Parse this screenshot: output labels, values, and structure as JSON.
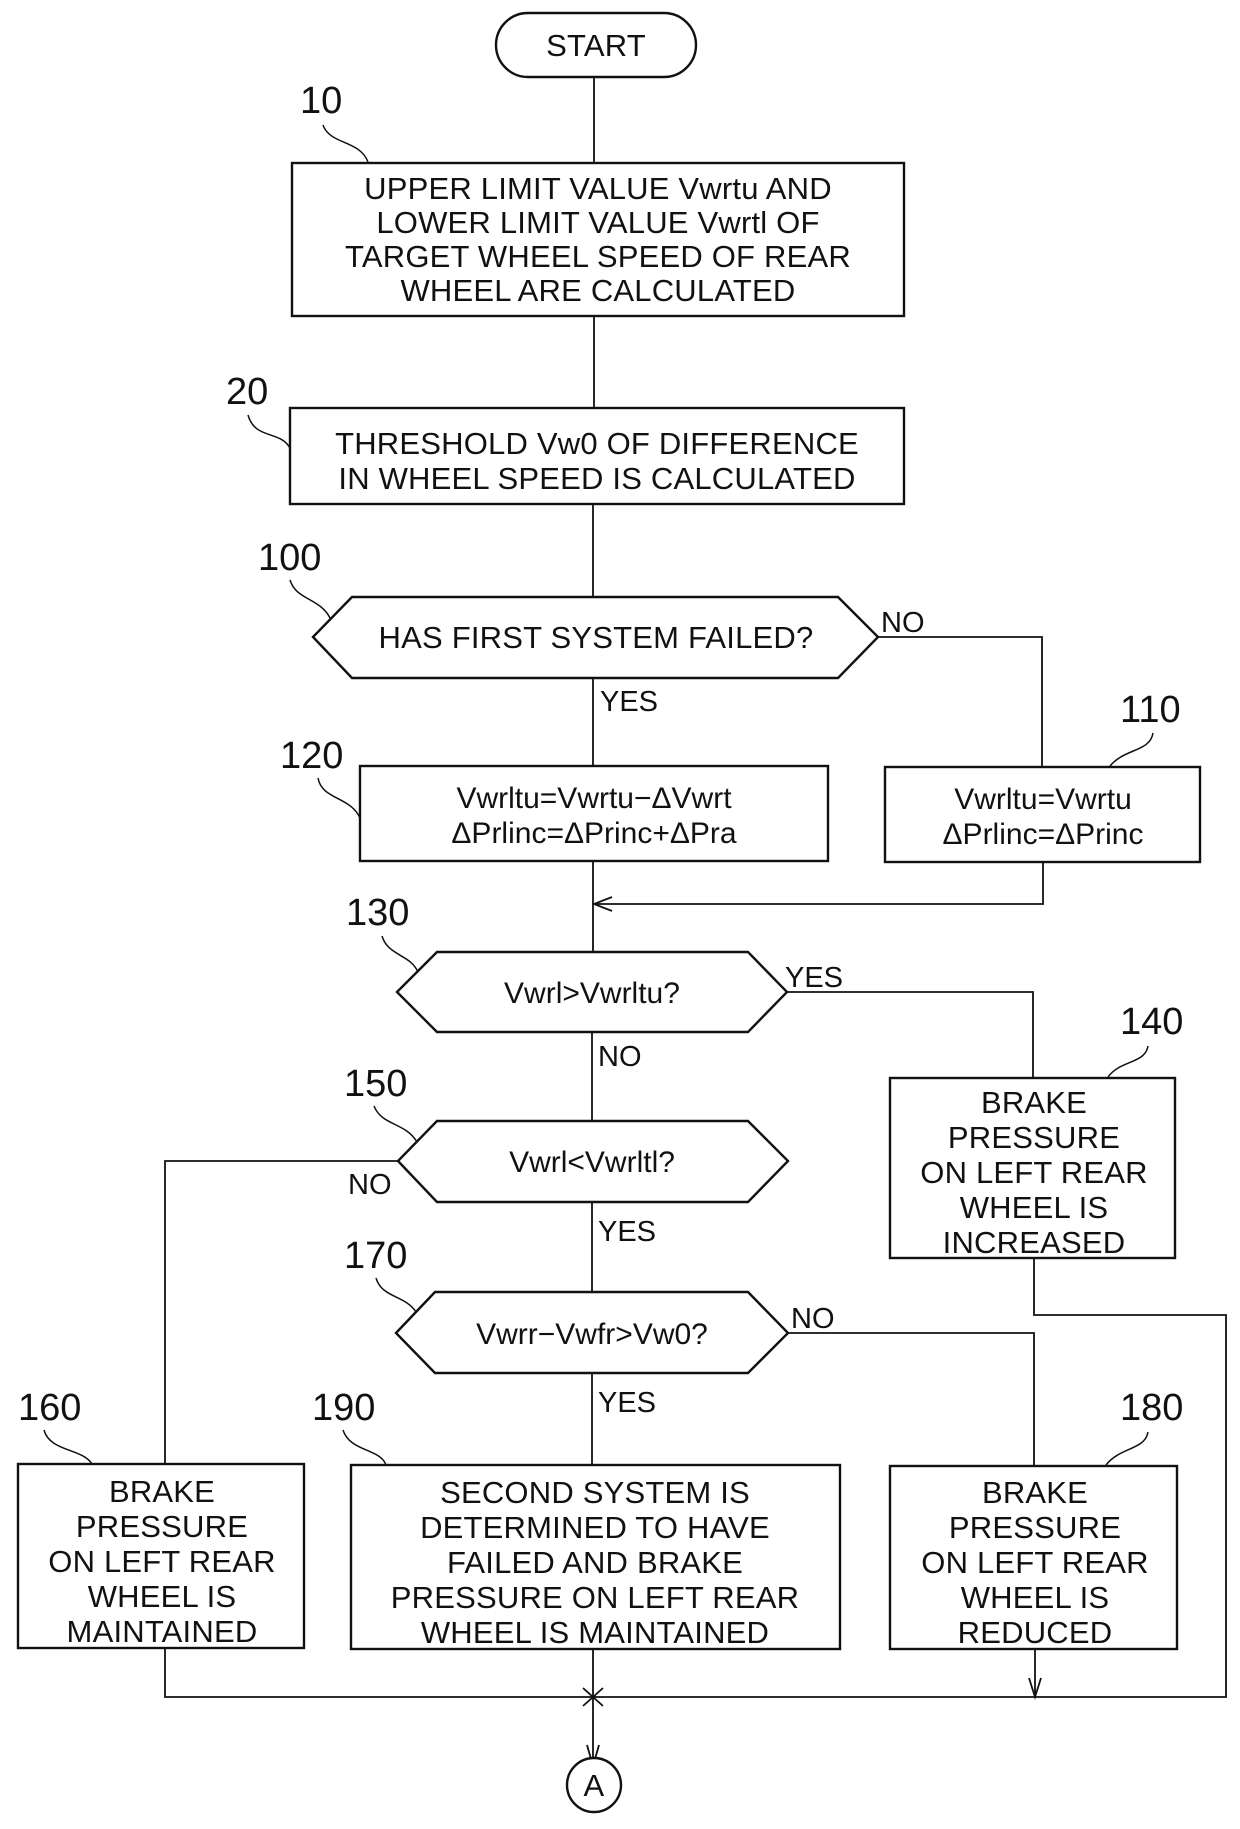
{
  "figure": {
    "type": "flowchart",
    "start_label": "START",
    "end_connector_label": "A",
    "nodes": [
      {
        "id": "10",
        "kind": "process",
        "ref": "10",
        "lines": [
          "UPPER LIMIT VALUE Vwrtu AND",
          "LOWER LIMIT VALUE Vwrtl OF",
          "TARGET WHEEL SPEED OF REAR",
          "WHEEL ARE CALCULATED"
        ]
      },
      {
        "id": "20",
        "kind": "process",
        "ref": "20",
        "lines": [
          "THRESHOLD Vw0 OF DIFFERENCE",
          "IN WHEEL SPEED IS CALCULATED"
        ]
      },
      {
        "id": "100",
        "kind": "decision",
        "ref": "100",
        "lines": [
          "HAS FIRST SYSTEM FAILED?"
        ],
        "yes": "120",
        "no": "110"
      },
      {
        "id": "110",
        "kind": "process",
        "ref": "110",
        "lines": [
          "Vwrltu=Vwrtu",
          "ΔPrlinc=ΔPrinc"
        ]
      },
      {
        "id": "120",
        "kind": "process",
        "ref": "120",
        "lines": [
          "Vwrltu=Vwrtu−ΔVwrt",
          "ΔPrlinc=ΔPrinc+ΔPra"
        ]
      },
      {
        "id": "130",
        "kind": "decision",
        "ref": "130",
        "lines": [
          "Vwrl>Vwrltu?"
        ],
        "yes": "140",
        "no": "150"
      },
      {
        "id": "140",
        "kind": "process",
        "ref": "140",
        "lines": [
          "BRAKE",
          "PRESSURE",
          "ON LEFT REAR",
          "WHEEL IS",
          "INCREASED"
        ]
      },
      {
        "id": "150",
        "kind": "decision",
        "ref": "150",
        "lines": [
          "Vwrl<Vwrltl?"
        ],
        "yes": "170",
        "no": "160"
      },
      {
        "id": "160",
        "kind": "process",
        "ref": "160",
        "lines": [
          "BRAKE",
          "PRESSURE",
          "ON LEFT REAR",
          "WHEEL IS",
          "MAINTAINED"
        ]
      },
      {
        "id": "170",
        "kind": "decision",
        "ref": "170",
        "lines": [
          "Vwrr−Vwfr>Vw0?"
        ],
        "yes": "190",
        "no": "180"
      },
      {
        "id": "180",
        "kind": "process",
        "ref": "180",
        "lines": [
          "BRAKE",
          "PRESSURE",
          "ON LEFT REAR",
          "WHEEL IS",
          "REDUCED"
        ]
      },
      {
        "id": "190",
        "kind": "process",
        "ref": "190",
        "lines": [
          "SECOND SYSTEM IS",
          "DETERMINED TO HAVE",
          "FAILED AND BRAKE",
          "PRESSURE ON LEFT REAR",
          "WHEEL IS MAINTAINED"
        ]
      }
    ],
    "branch_labels": {
      "d100_no": "NO",
      "d100_yes": "YES",
      "d130_yes": "YES",
      "d130_no": "NO",
      "d150_no": "NO",
      "d150_yes": "YES",
      "d170_no": "NO",
      "d170_yes": "YES"
    }
  }
}
